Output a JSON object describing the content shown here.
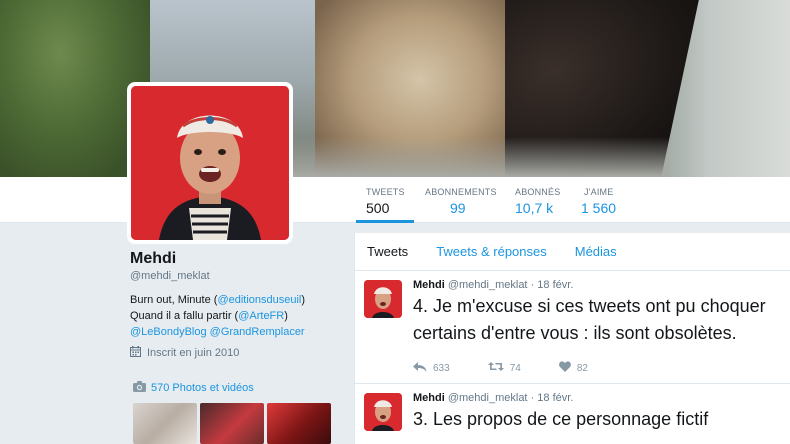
{
  "profile": {
    "name": "Mehdi",
    "handle": "@mehdi_meklat",
    "bio_line1_prefix": "Burn out, Minute (",
    "bio_line1_link": "@editionsduseuil",
    "bio_line1_suffix": ")",
    "bio_line2_prefix": "Quand il a fallu partir (",
    "bio_line2_link": "@ArteFR",
    "bio_line2_suffix": ")",
    "bio_line3_link1": "@LeBondyBlog",
    "bio_line3_link2": "@GrandRemplacer",
    "joined": "Inscrit en juin 2010",
    "photos_label": "570 Photos et vidéos"
  },
  "stats": [
    {
      "label": "TWEETS",
      "value": "500"
    },
    {
      "label": "ABONNEMENTS",
      "value": "99"
    },
    {
      "label": "ABONNÉS",
      "value": "10,7 k"
    },
    {
      "label": "J'AIME",
      "value": "1 560"
    }
  ],
  "tabs": [
    "Tweets",
    "Tweets & réponses",
    "Médias"
  ],
  "tweets": [
    {
      "name": "Mehdi",
      "handle": "@mehdi_meklat",
      "sep": "·",
      "date": "18 févr.",
      "text": "4. Je m'excuse si ces tweets ont pu choquer certains d'entre vous : ils sont obsolètes.",
      "replies": "633",
      "retweets": "74",
      "likes": "82"
    },
    {
      "name": "Mehdi",
      "handle": "@mehdi_meklat",
      "sep": "·",
      "date": "18 févr.",
      "text": "3. Les propos de ce personnage fictif"
    }
  ],
  "colors": {
    "accent": "#1b95e0",
    "avatar_bg": "#d8292f",
    "page_bg": "#e6ecf0"
  }
}
